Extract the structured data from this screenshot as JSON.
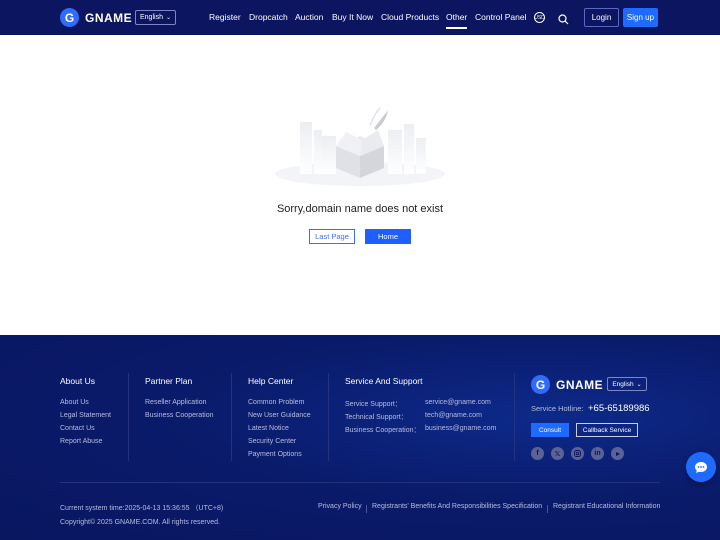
{
  "header": {
    "logo_text": "GNAME",
    "logo_letter": "G",
    "language": "English",
    "nav": [
      "Register",
      "Dropcatch",
      "Auction",
      "Buy It Now",
      "Cloud Products",
      "Other",
      "Control Panel"
    ],
    "active_nav": "Other",
    "currency_icon": "USD",
    "login": "Login",
    "signup": "Sign up"
  },
  "main": {
    "message": "Sorry,domain name does not exist",
    "last_page": "Last Page",
    "home": "Home"
  },
  "footer": {
    "about": {
      "title": "About Us",
      "links": [
        "About Us",
        "Legal Statement",
        "Contact Us",
        "Report Abuse"
      ]
    },
    "partner": {
      "title": "Partner Plan",
      "links": [
        "Reseller Application",
        "Business Cooperation"
      ]
    },
    "help": {
      "title": "Help Center",
      "links": [
        "Common Problem",
        "New User Guidance",
        "Latest Notice",
        "Security Center",
        "Payment Options"
      ]
    },
    "support": {
      "title": "Service And Support",
      "rows": [
        {
          "label": "Service Support：",
          "value": "service@gname.com"
        },
        {
          "label": "Technical Support：",
          "value": "tech@gname.com"
        },
        {
          "label": "Business Cooperation：",
          "value": "business@gname.com"
        }
      ]
    },
    "brand": {
      "logo_text": "GNAME",
      "logo_letter": "G",
      "language": "English",
      "hotline_label": "Service Hotline:",
      "hotline": "+65-65189986",
      "consult": "Consult",
      "callback": "Callback Service",
      "socials": [
        "facebook-icon",
        "x-icon",
        "instagram-icon",
        "linkedin-icon",
        "youtube-icon"
      ]
    },
    "system_time": "Current system time:2025-04-13 15:36:55 （UTC+8)",
    "copyright": "Copyright© 2025 GNAME.COM. All rights reserved.",
    "bottom_links": [
      "Privacy Policy",
      "Registrants' Benefits And Responsibilities Specification",
      "Registrant Educational Information"
    ]
  },
  "colors": {
    "header_bg": "#0b1560",
    "accent": "#1f6bff",
    "footer_bg": "#0a1b6b"
  }
}
